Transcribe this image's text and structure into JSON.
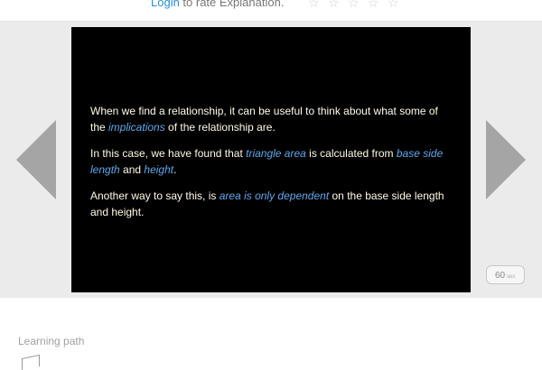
{
  "rating": {
    "login_label": "Login",
    "prompt": " to rate Explanation.",
    "stars": [
      "☆",
      "☆",
      "☆",
      "☆",
      "☆"
    ]
  },
  "slide": {
    "p1": {
      "t1": "When we find a relationship, it can be useful to think about what some of the ",
      "h1": "implications",
      "t2": " of the relationship are."
    },
    "p2": {
      "t1": "In this case, we have found that ",
      "h1": "triangle area",
      "t2": " is calculated from ",
      "h2": "base side length",
      "t3": " and ",
      "h3": "height",
      "t4": "."
    },
    "p3": {
      "t1": "Another way to say this, is ",
      "h1": "area is only dependent",
      "t2": " on the base side length and height."
    }
  },
  "speed": {
    "value": "60",
    "unit": "sec"
  },
  "learning_path": {
    "label": "Learning path"
  },
  "colors": {
    "link": "#2b8fd6",
    "highlight": "#5ea8ec",
    "slide_bg": "#000000",
    "arrow": "#a5a5a5"
  },
  "icons": [
    "star-icon",
    "prev-arrow-icon",
    "next-arrow-icon",
    "learning-path-icon"
  ]
}
